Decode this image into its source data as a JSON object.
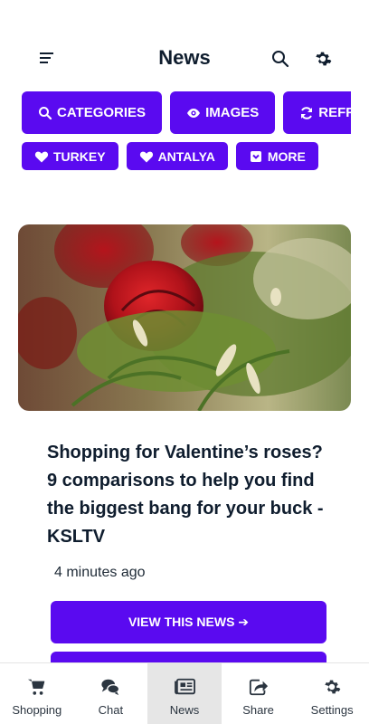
{
  "header": {
    "title": "News",
    "icons": [
      "menu-icon",
      "search-icon",
      "gear-icon"
    ]
  },
  "chips": {
    "row1": [
      {
        "label": "CATEGORIES",
        "icon": "search-icon"
      },
      {
        "label": "IMAGES",
        "icon": "eye-icon"
      },
      {
        "label": "REFRESH",
        "icon": "refresh-icon"
      }
    ],
    "row2": [
      {
        "label": "TURKEY",
        "icon": "heart-icon"
      },
      {
        "label": "ANTALYA",
        "icon": "heart-icon"
      },
      {
        "label": "MORE",
        "icon": "chevron-box-icon"
      }
    ]
  },
  "article": {
    "headline": "Shopping for Valentine’s roses? 9 comparisons to help you find the biggest bang for your buck - KSLTV",
    "time": "4 minutes ago",
    "view_label": "VIEW THIS NEWS ➔"
  },
  "tabbar": {
    "tabs": [
      {
        "label": "Shopping",
        "icon": "cart-icon"
      },
      {
        "label": "Chat",
        "icon": "chat-icon"
      },
      {
        "label": "News",
        "icon": "newspaper-icon",
        "active": true
      },
      {
        "label": "Share",
        "icon": "share-icon"
      },
      {
        "label": "Settings",
        "icon": "gear-icon"
      }
    ]
  },
  "colors": {
    "accent": "#5a0af0",
    "text": "#0f1d2e",
    "active_tab_bg": "#e6e6e6"
  }
}
